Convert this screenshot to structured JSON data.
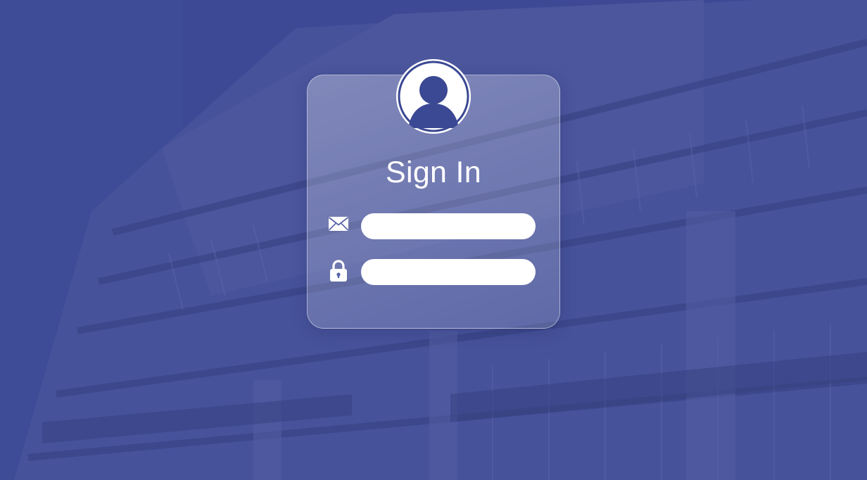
{
  "background": {
    "overlay_color": "#3b4893",
    "description_icon": "building-icon"
  },
  "login": {
    "title": "Sign In",
    "avatar_icon": "user-avatar-icon",
    "email": {
      "icon": "envelope-icon",
      "value": "",
      "placeholder": ""
    },
    "password": {
      "icon": "lock-icon",
      "value": "",
      "placeholder": ""
    }
  },
  "colors": {
    "brand_blue": "#3b4893",
    "card_border": "#ffffff",
    "text": "#ffffff"
  }
}
